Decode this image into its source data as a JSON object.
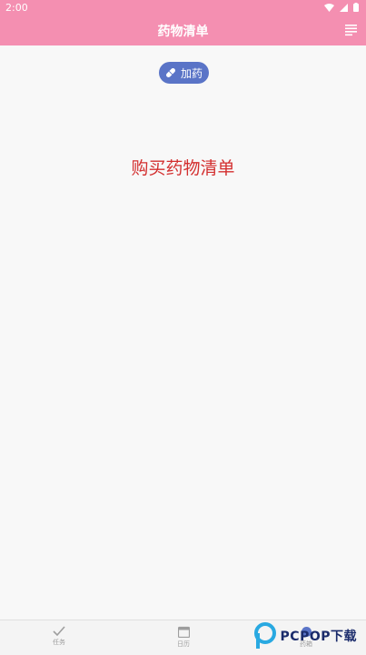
{
  "status_bar": {
    "time": "2:00",
    "icons": [
      "wifi-icon",
      "signal-icon",
      "battery-icon"
    ]
  },
  "app_bar": {
    "title": "药物清单",
    "menu_icon": "list-icon"
  },
  "add_button": {
    "label": "加药",
    "icon": "pill-icon"
  },
  "main": {
    "headline": "购买药物清单"
  },
  "bottom_nav": {
    "tabs": [
      {
        "label": "任务",
        "icon": "check-icon"
      },
      {
        "label": "日历",
        "icon": "calendar-icon"
      },
      {
        "label": "药箱",
        "icon": "medicine-icon"
      }
    ]
  },
  "watermark": {
    "text": "PCPOP下载"
  },
  "colors": {
    "app_bar": "#f48fb1",
    "pill": "#5a74c7",
    "headline": "#d32f2f"
  }
}
